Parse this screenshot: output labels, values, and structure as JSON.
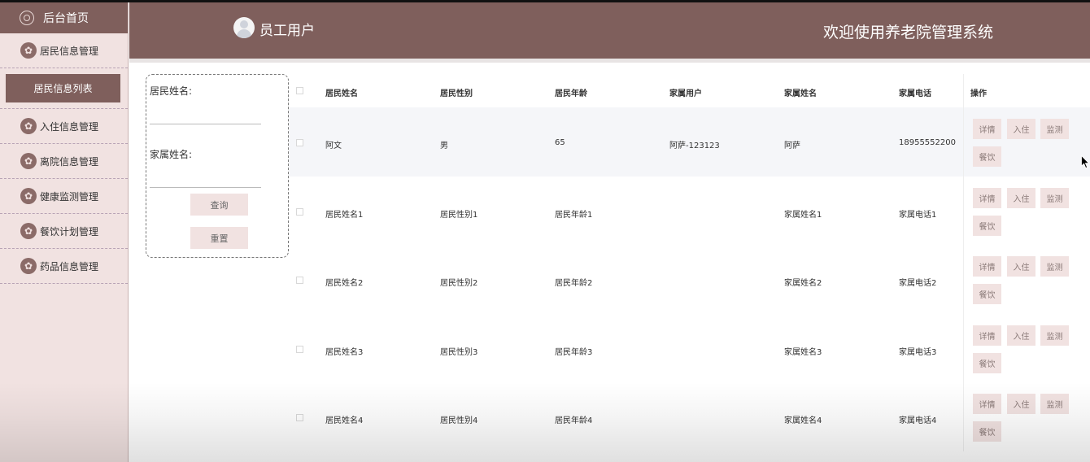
{
  "sidebar": {
    "home_label": "后台首页",
    "items": [
      {
        "label": "居民信息管理"
      },
      {
        "label": "入住信息管理"
      },
      {
        "label": "离院信息管理"
      },
      {
        "label": "健康监测管理"
      },
      {
        "label": "餐饮计划管理"
      },
      {
        "label": "药品信息管理"
      }
    ],
    "active_sub": "居民信息列表"
  },
  "header": {
    "user_title": "员工用户",
    "site_title": "欢迎使用养老院管理系统"
  },
  "search": {
    "resident_name_label": "居民姓名:",
    "resident_name_value": "",
    "family_name_label": "家属姓名:",
    "family_name_value": "",
    "query_label": "查询",
    "reset_label": "重置"
  },
  "table": {
    "headers": [
      "居民姓名",
      "居民性别",
      "居民年龄",
      "家属用户",
      "家属姓名",
      "家属电话",
      "操作"
    ],
    "actions": [
      "详情",
      "入住",
      "监测",
      "餐饮"
    ],
    "rows": [
      {
        "name": "阿文",
        "gender": "男",
        "age": "65",
        "family_user": "阿萨-123123",
        "family_name": "阿萨",
        "family_phone": "18955552200"
      },
      {
        "name": "居民姓名1",
        "gender": "居民性别1",
        "age": "居民年龄1",
        "family_user": "",
        "family_name": "家属姓名1",
        "family_phone": "家属电话1"
      },
      {
        "name": "居民姓名2",
        "gender": "居民性别2",
        "age": "居民年龄2",
        "family_user": "",
        "family_name": "家属姓名2",
        "family_phone": "家属电话2"
      },
      {
        "name": "居民姓名3",
        "gender": "居民性别3",
        "age": "居民年龄3",
        "family_user": "",
        "family_name": "家属姓名3",
        "family_phone": "家属电话3"
      },
      {
        "name": "居民姓名4",
        "gender": "居民性别4",
        "age": "居民年龄4",
        "family_user": "",
        "family_name": "家属姓名4",
        "family_phone": "家属电话4"
      }
    ]
  },
  "colors": {
    "accent": "#7f5f5c",
    "sidebar_bg": "#f1e2e1",
    "button_bg": "#f1e2e1"
  }
}
